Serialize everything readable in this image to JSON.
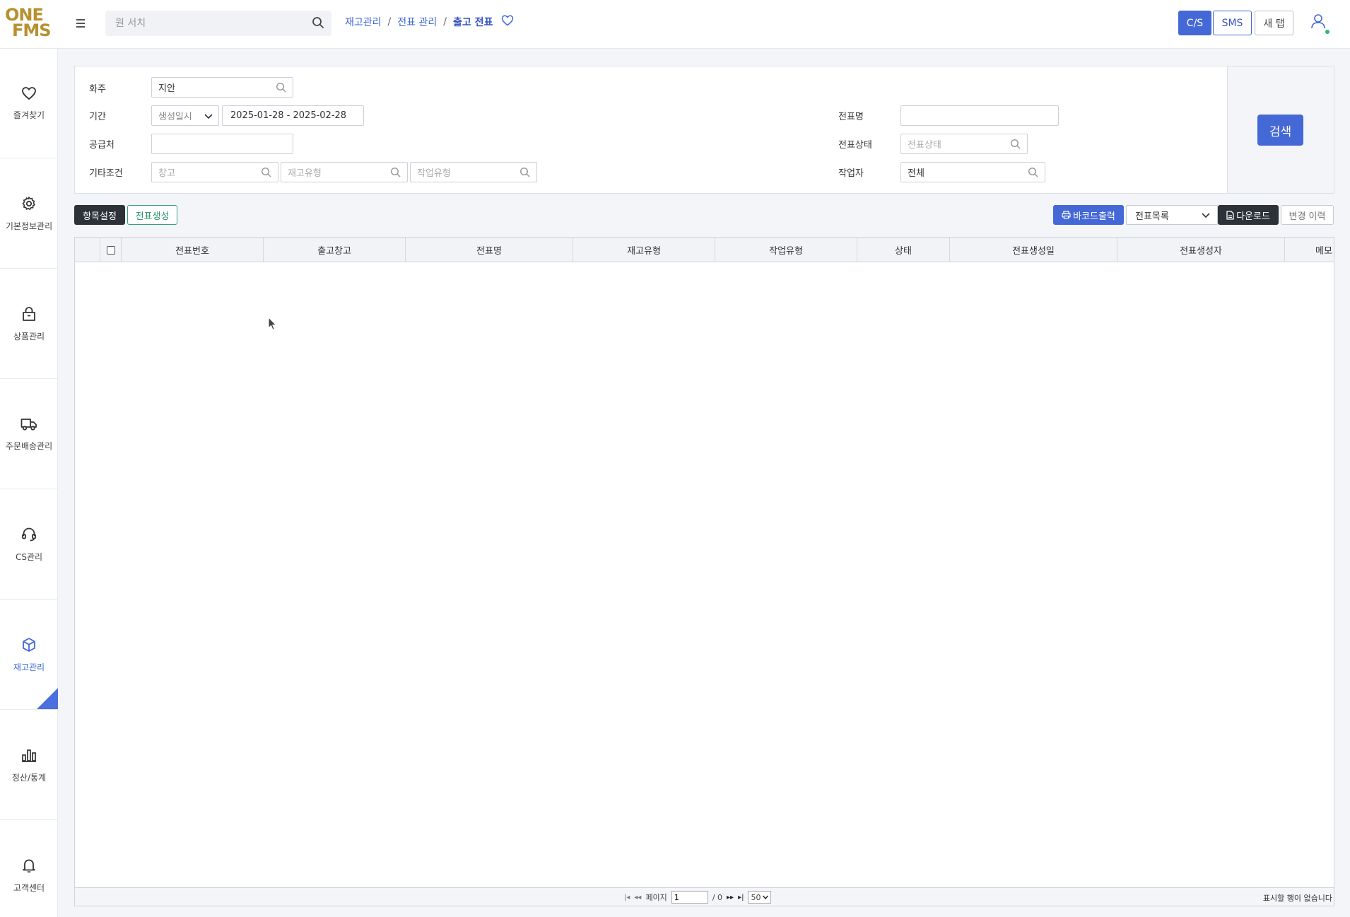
{
  "header": {
    "logo_line1": "ONE",
    "logo_line2": "FMS",
    "search_placeholder": "원 서치",
    "breadcrumb": [
      "재고관리",
      "전표 관리",
      "출고 전표"
    ],
    "buttons": {
      "cs": "C/S",
      "sms": "SMS",
      "new_tab": "새 탭"
    }
  },
  "sidebar": {
    "items": [
      {
        "label": "즐겨찾기",
        "icon": "heart-icon"
      },
      {
        "label": "기본정보관리",
        "icon": "gear-icon"
      },
      {
        "label": "상품관리",
        "icon": "bag-icon"
      },
      {
        "label": "주문배송관리",
        "icon": "truck-icon"
      },
      {
        "label": "CS관리",
        "icon": "headset-icon"
      },
      {
        "label": "재고관리",
        "icon": "box-icon",
        "active": true
      },
      {
        "label": "정산/통계",
        "icon": "bar-chart-icon"
      },
      {
        "label": "고객센터",
        "icon": "bell-icon"
      }
    ]
  },
  "filters": {
    "owner_label": "화주",
    "owner_value": "지안",
    "period_label": "기간",
    "period_type": "생성일시",
    "period_range": "2025-01-28 - 2025-02-28",
    "supplier_label": "공급처",
    "supplier_value": "",
    "etc_label": "기타조건",
    "warehouse_placeholder": "창고",
    "stock_type_placeholder": "재고유형",
    "work_type_placeholder": "작업유형",
    "slip_name_label": "전표명",
    "slip_name_value": "",
    "slip_status_label": "전표상태",
    "slip_status_placeholder": "전표상태",
    "worker_label": "작업자",
    "worker_value": "전체",
    "search_button": "검색"
  },
  "toolbar": {
    "column_settings": "항목설정",
    "create_slip": "전표생성",
    "barcode_print": "바코드출력",
    "list_select": "전표목록",
    "download": "다운로드",
    "change_history": "변경 이력"
  },
  "table": {
    "columns": [
      "전표번호",
      "출고창고",
      "전표명",
      "재고유형",
      "작업유형",
      "상태",
      "전표생성일",
      "전표생성자",
      "메모"
    ],
    "rows": []
  },
  "footer": {
    "page_label": "페이지",
    "page_value": "1",
    "page_total": "/ 0",
    "page_size": "50",
    "no_rows": "표시할 행이 없습니다"
  },
  "colors": {
    "accent": "#4468d6",
    "brand": "#b8902f",
    "dark_button": "#2d3138",
    "green": "#34a37a"
  }
}
